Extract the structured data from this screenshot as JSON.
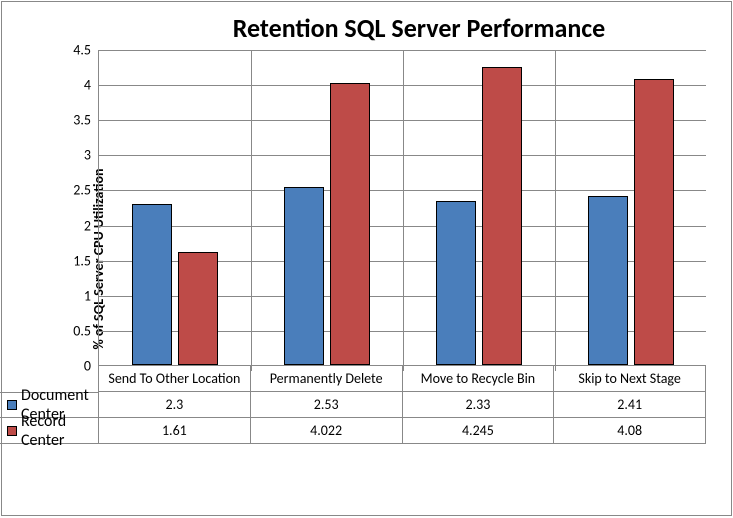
{
  "chart_data": {
    "type": "bar",
    "title": "Retention SQL Server Performance",
    "ylabel": "% of SQL Server CPU Utilization",
    "categories": [
      "Send To Other Location",
      "Permanently Delete",
      "Move to Recycle Bin",
      "Skip to Next Stage"
    ],
    "series": [
      {
        "name": "Document Center",
        "color": "#4a7ebb",
        "values": [
          2.3,
          2.53,
          2.33,
          2.41
        ]
      },
      {
        "name": "Record Center",
        "color": "#be4b48",
        "values": [
          1.61,
          4.022,
          4.245,
          4.08
        ]
      }
    ],
    "ylim": [
      0,
      4.5
    ],
    "yticks": [
      0,
      0.5,
      1,
      1.5,
      2,
      2.5,
      3,
      3.5,
      4,
      4.5
    ]
  },
  "table_display": {
    "s1": [
      "2.3",
      "2.53",
      "2.33",
      "2.41"
    ],
    "s2": [
      "1.61",
      "4.022",
      "4.245",
      "4.08"
    ]
  }
}
